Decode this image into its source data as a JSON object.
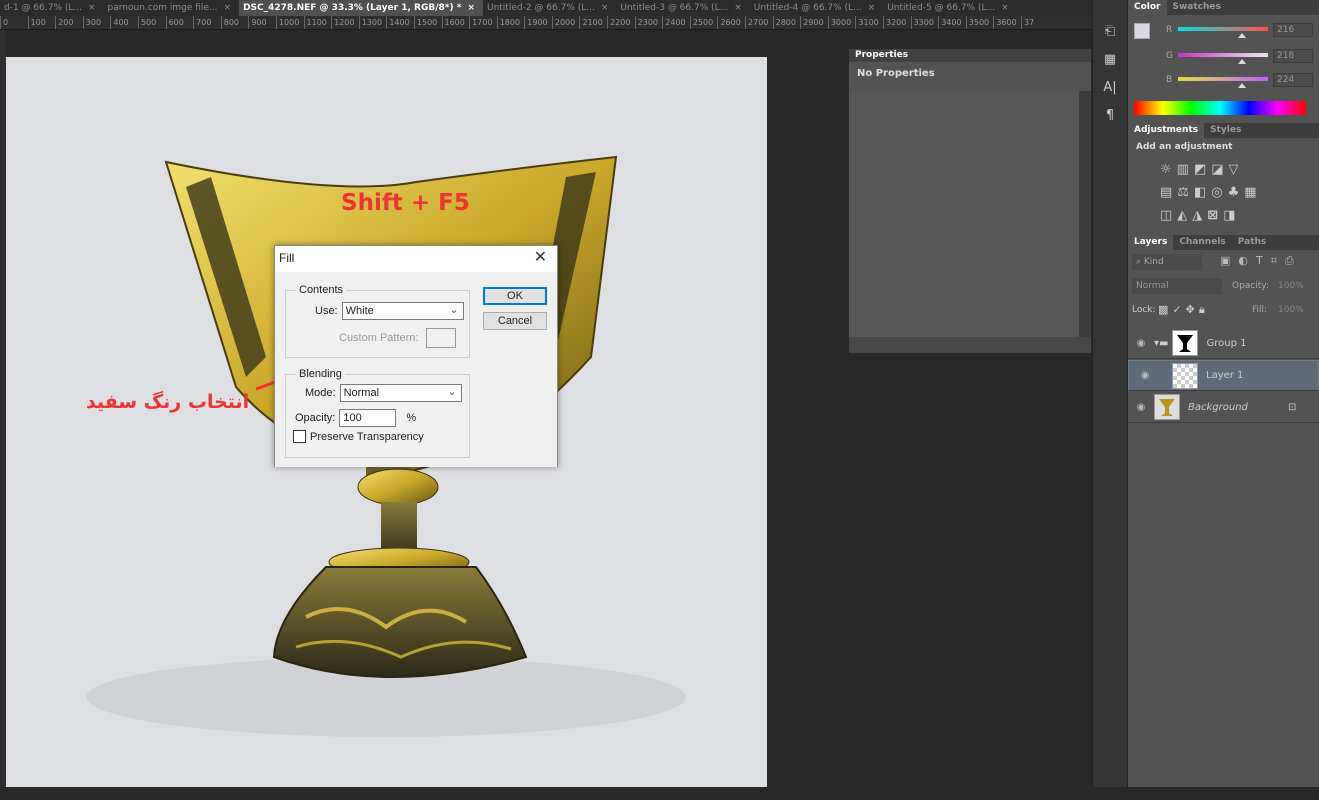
{
  "tabs": [
    {
      "label": "d-1 @ 66.7% (L...",
      "active": false
    },
    {
      "label": "parnoun.com imge file...",
      "active": false
    },
    {
      "label": "DSC_4278.NEF @ 33.3% (Layer 1, RGB/8*) *",
      "active": true
    },
    {
      "label": "Untitled-2 @ 66.7% (L...",
      "active": false
    },
    {
      "label": "Untitled-3 @ 66.7% (L...",
      "active": false
    },
    {
      "label": "Untitled-4 @ 66.7% (L...",
      "active": false
    },
    {
      "label": "Untitled-5 @ 66.7% (L...",
      "active": false
    }
  ],
  "tab_close": "×",
  "ruler_ticks": [
    "0",
    "100",
    "200",
    "300",
    "400",
    "500",
    "600",
    "700",
    "800",
    "900",
    "1000",
    "1100",
    "1200",
    "1300",
    "1400",
    "1500",
    "1600",
    "1700",
    "1800",
    "1900",
    "2000",
    "2100",
    "2200",
    "2300",
    "2400",
    "2500",
    "2600",
    "2700",
    "2800",
    "2900",
    "3000",
    "3100",
    "3200",
    "3300",
    "3400",
    "3500",
    "3600",
    "37"
  ],
  "annotations": {
    "shortcut": "Shift + F5",
    "note": "انتخاب رنگ سفید"
  },
  "fill_dialog": {
    "title": "Fill",
    "close": "✕",
    "contents_legend": "Contents",
    "use_label": "Use:",
    "use_value": "White",
    "custom_pattern_label": "Custom Pattern:",
    "blending_legend": "Blending",
    "mode_label": "Mode:",
    "mode_value": "Normal",
    "opacity_label": "Opacity:",
    "opacity_value": "100",
    "opacity_unit": "%",
    "preserve_label": "Preserve Transparency",
    "ok": "OK",
    "cancel": "Cancel"
  },
  "properties": {
    "title": "Properties",
    "empty": "No Properties"
  },
  "color_panel": {
    "tabs": [
      "Color",
      "Swatches"
    ],
    "r": {
      "label": "R",
      "value": "216"
    },
    "g": {
      "label": "G",
      "value": "218"
    },
    "b": {
      "label": "B",
      "value": "224"
    },
    "foreground": "#d8dae0"
  },
  "adjustments": {
    "tabs": [
      "Adjustments",
      "Styles"
    ],
    "hint": "Add an adjustment"
  },
  "layers_panel": {
    "tabs": [
      "Layers",
      "Channels",
      "Paths"
    ],
    "kind": "Kind",
    "blend": "Normal",
    "opacity_label": "Opacity:",
    "opacity_value": "100%",
    "lock_label": "Lock:",
    "fill_label": "Fill:",
    "fill_value": "100%",
    "layers": [
      {
        "name": "Group 1",
        "selected": false
      },
      {
        "name": "Layer 1",
        "selected": true
      },
      {
        "name": "Background",
        "selected": false
      }
    ]
  }
}
